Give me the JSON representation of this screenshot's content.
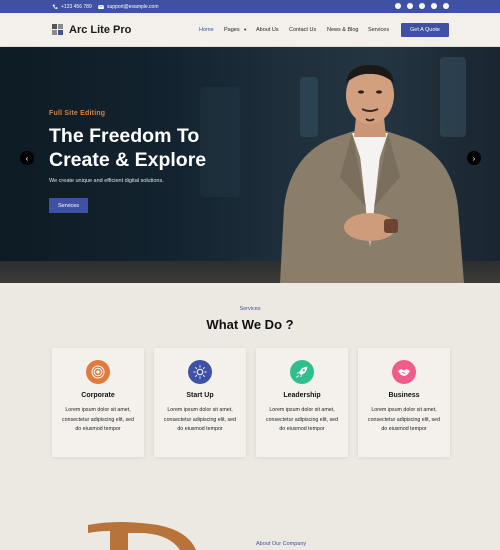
{
  "topbar": {
    "phone": "+123 456 789",
    "email": "support@example.com",
    "social": [
      "facebook-icon",
      "twitter-icon",
      "youtube-icon",
      "instagram-icon",
      "dribbble-icon"
    ]
  },
  "header": {
    "logo_text": "Arc Lite Pro",
    "nav": [
      "Home",
      "Pages",
      "About Us",
      "Contact Us",
      "News & Blog",
      "Services"
    ],
    "cta": "Get A Quote"
  },
  "hero": {
    "eyebrow": "Full Site Editing",
    "title_line1": "The Freedom To",
    "title_line2": "Create & Explore",
    "subtitle": "We create unique and efficient digital solutions.",
    "button": "Services"
  },
  "services": {
    "eyebrow": "Services",
    "title": "What We Do ?",
    "cards": [
      {
        "title": "Corporate",
        "text": "Lorem ipsum dolor sit amet, consectetur adipiscing elit, sed do eiusmod tempor",
        "color": "#e07a3e",
        "icon": "target-icon"
      },
      {
        "title": "Start Up",
        "text": "Lorem ipsum dolor sit amet, consectetur adipiscing elit, sed do eiusmod tempor",
        "color": "#3f51a3",
        "icon": "sun-icon"
      },
      {
        "title": "Leadership",
        "text": "Lorem ipsum dolor sit amet, consectetur adipiscing elit, sed do eiusmod tempor",
        "color": "#2fbf8f",
        "icon": "rocket-icon"
      },
      {
        "title": "Business",
        "text": "Lorem ipsum dolor sit amet, consectetur adipiscing elit, sed do eiusmod tempor",
        "color": "#ef5c8a",
        "icon": "handshake-icon"
      }
    ]
  },
  "about": {
    "label": "About Our Company"
  },
  "colors": {
    "primary": "#3f51a3",
    "accent": "#d9803c",
    "background": "#ece8e2"
  }
}
